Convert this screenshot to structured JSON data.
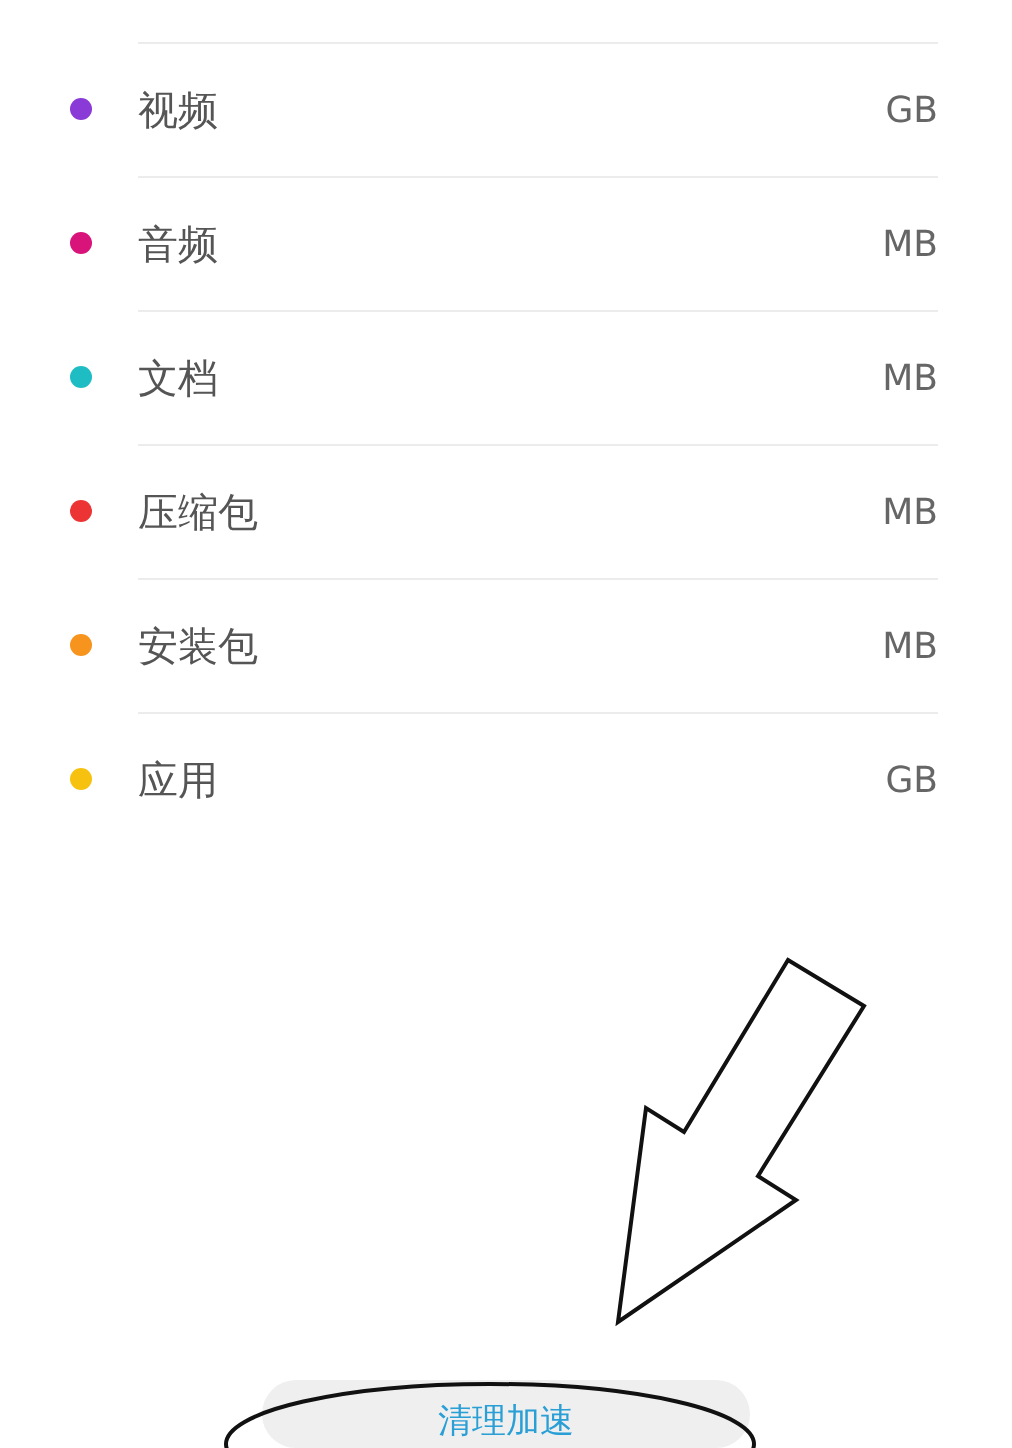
{
  "categories": [
    {
      "name": "视频",
      "unit": "GB",
      "color": "#8a3ad6"
    },
    {
      "name": "音频",
      "unit": "MB",
      "color": "#d8147a"
    },
    {
      "name": "文档",
      "unit": "MB",
      "color": "#1ebdc4"
    },
    {
      "name": "压缩包",
      "unit": "MB",
      "color": "#ec3434"
    },
    {
      "name": "安装包",
      "unit": "MB",
      "color": "#f7941d"
    },
    {
      "name": "应用",
      "unit": "GB",
      "color": "#f7c20f"
    }
  ],
  "button": {
    "label": "清理加速"
  }
}
